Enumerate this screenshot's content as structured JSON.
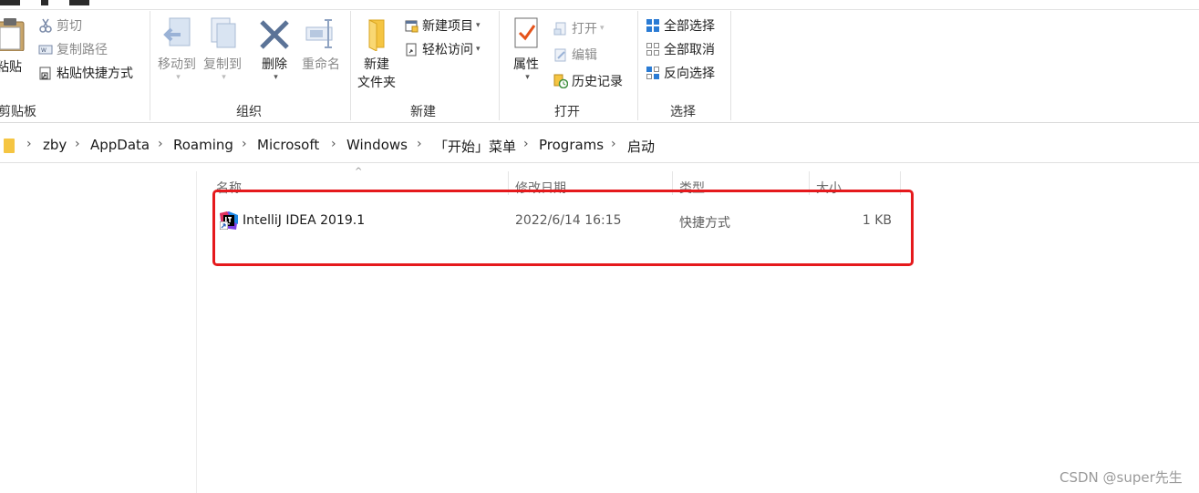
{
  "ribbon": {
    "clipboard": {
      "paste_label": "粘贴",
      "cut_label": "剪切",
      "copy_path_label": "复制路径",
      "paste_shortcut_label": "粘贴快捷方式",
      "group_label": "剪贴板"
    },
    "organize": {
      "move_to_label": "移动到",
      "copy_to_label": "复制到",
      "delete_label": "删除",
      "rename_label": "重命名",
      "group_label": "组织"
    },
    "new": {
      "new_folder_line1": "新建",
      "new_folder_line2": "文件夹",
      "new_item_label": "新建项目",
      "easy_access_label": "轻松访问",
      "group_label": "新建"
    },
    "open": {
      "properties_label": "属性",
      "open_label": "打开",
      "edit_label": "编辑",
      "history_label": "历史记录",
      "group_label": "打开"
    },
    "select": {
      "select_all_label": "全部选择",
      "select_none_label": "全部取消",
      "invert_label": "反向选择",
      "group_label": "选择"
    }
  },
  "address": {
    "crumbs": [
      "zby",
      "AppData",
      "Roaming",
      "Microsoft",
      "Windows",
      "「开始」菜单",
      "Programs",
      "启动"
    ],
    "separator": "›"
  },
  "columns": {
    "name": "名称",
    "modified": "修改日期",
    "type": "类型",
    "size": "大小"
  },
  "files": [
    {
      "name": "IntelliJ IDEA 2019.1",
      "modified": "2022/6/14 16:15",
      "type": "快捷方式",
      "size": "1 KB"
    }
  ],
  "watermark": "CSDN @super先生",
  "colors": {
    "highlight_border": "#e5191c",
    "folder": "#f5c542",
    "accent_blue": "#2a7bd4"
  }
}
